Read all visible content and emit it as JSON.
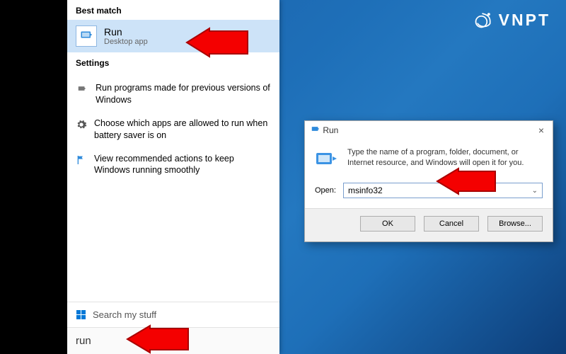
{
  "logo": {
    "text": "VNPT"
  },
  "start": {
    "best_match_label": "Best match",
    "run_result": {
      "title": "Run",
      "subtitle": "Desktop app"
    },
    "settings_label": "Settings",
    "settings_items": [
      "Run programs made for previous versions of Windows",
      "Choose which apps are allowed to run when battery saver is on",
      "View recommended actions to keep Windows running smoothly"
    ],
    "search_stuff_label": "Search my stuff",
    "search_value": "run"
  },
  "run_dialog": {
    "title": "Run",
    "description": "Type the name of a program, folder, document, or Internet resource, and Windows will open it for you.",
    "open_label": "Open:",
    "open_value": "msinfo32",
    "buttons": {
      "ok": "OK",
      "cancel": "Cancel",
      "browse": "Browse..."
    }
  }
}
